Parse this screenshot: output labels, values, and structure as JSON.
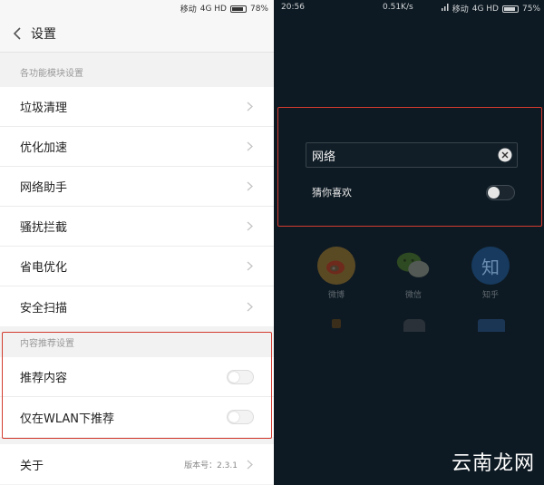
{
  "left": {
    "status": {
      "carrier": "移动",
      "network": "4G HD",
      "battery": "78%"
    },
    "header": {
      "title": "设置"
    },
    "section1": {
      "label": "各功能模块设置",
      "items": [
        {
          "label": "垃圾清理"
        },
        {
          "label": "优化加速"
        },
        {
          "label": "网络助手"
        },
        {
          "label": "骚扰拦截"
        },
        {
          "label": "省电优化"
        },
        {
          "label": "安全扫描"
        }
      ]
    },
    "section2": {
      "label": "内容推荐设置",
      "items": [
        {
          "label": "推荐内容",
          "enabled": false
        },
        {
          "label": "仅在WLAN下推荐",
          "enabled": false
        }
      ]
    },
    "about": {
      "label": "关于",
      "version": "版本号：2.3.1"
    }
  },
  "right": {
    "status": {
      "time": "20:56",
      "speed": "0.51K/s",
      "carrier": "移动",
      "network": "4G HD",
      "battery": "75%"
    },
    "search": {
      "value": "网络"
    },
    "guess": {
      "label": "猜你喜欢",
      "enabled": false
    },
    "apps": [
      {
        "label": "微博",
        "icon": "weibo-icon",
        "color": "#f5a623"
      },
      {
        "label": "微信",
        "icon": "wechat-icon",
        "color": "#6bc23a"
      },
      {
        "label": "知乎",
        "icon": "zhihu-icon",
        "color": "#1f6fc4",
        "glyph": "知"
      }
    ],
    "watermark": "云南龙网"
  },
  "colors": {
    "highlight": "#d23a2e"
  }
}
